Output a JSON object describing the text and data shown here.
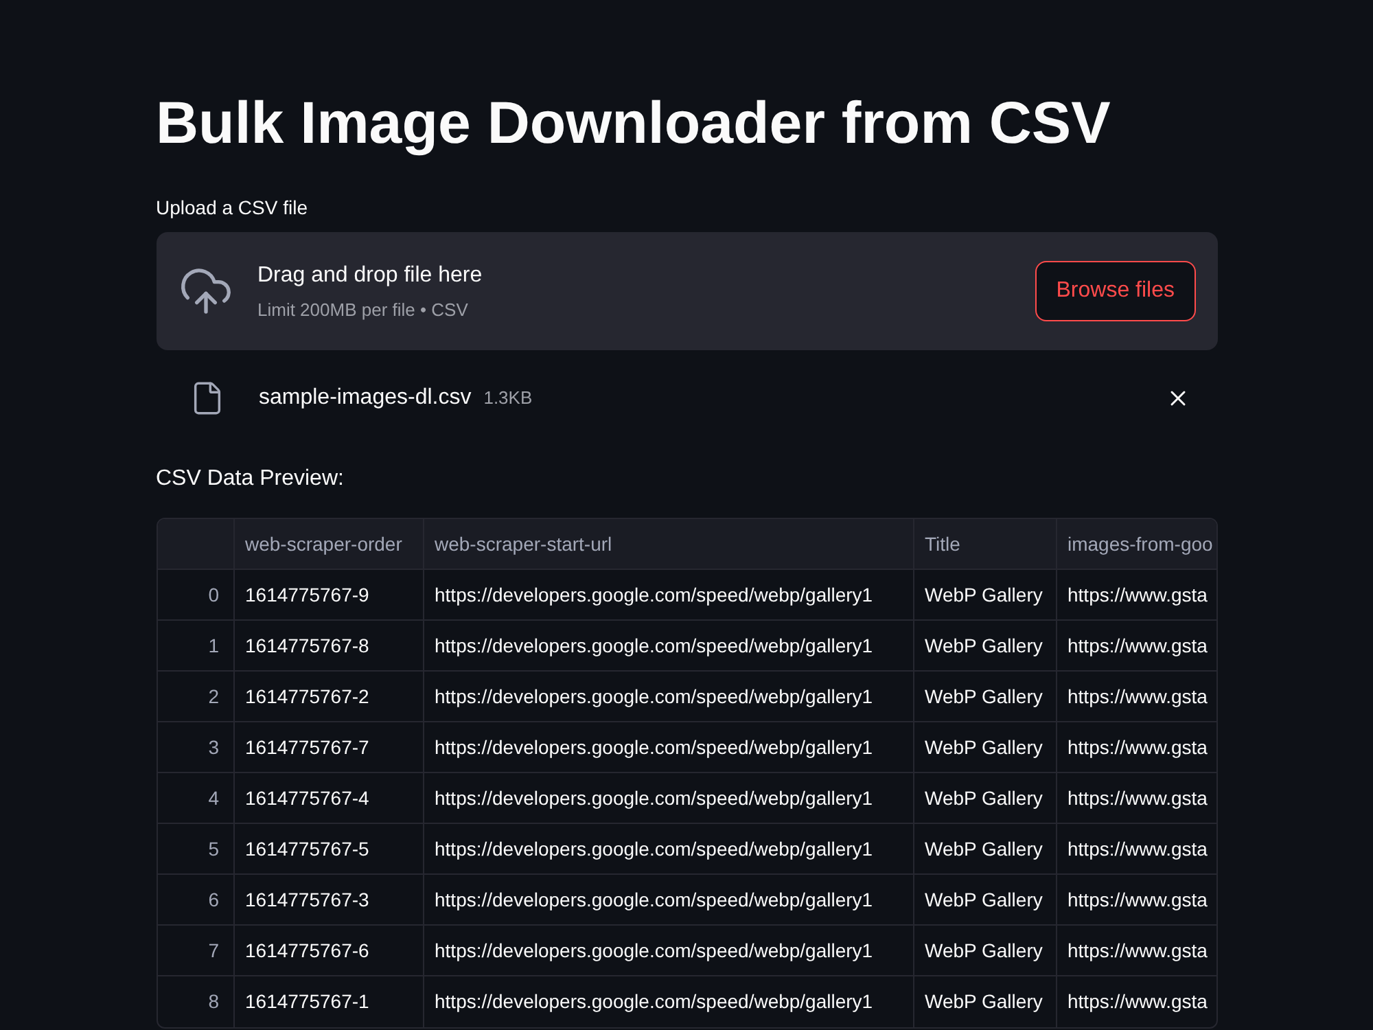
{
  "title": "Bulk Image Downloader from CSV",
  "uploader": {
    "label": "Upload a CSV file",
    "prompt": "Drag and drop file here",
    "limit": "Limit 200MB per file • CSV",
    "button": "Browse files"
  },
  "file": {
    "name": "sample-images-dl.csv",
    "size": "1.3KB"
  },
  "preview": {
    "heading": "CSV Data Preview:",
    "columns": [
      "web-scraper-order",
      "web-scraper-start-url",
      "Title",
      "images-from-goo"
    ],
    "rows": [
      {
        "index": "0",
        "cells": [
          "1614775767-9",
          "https://developers.google.com/speed/webp/gallery1",
          "WebP Gallery",
          "https://www.gsta"
        ]
      },
      {
        "index": "1",
        "cells": [
          "1614775767-8",
          "https://developers.google.com/speed/webp/gallery1",
          "WebP Gallery",
          "https://www.gsta"
        ]
      },
      {
        "index": "2",
        "cells": [
          "1614775767-2",
          "https://developers.google.com/speed/webp/gallery1",
          "WebP Gallery",
          "https://www.gsta"
        ]
      },
      {
        "index": "3",
        "cells": [
          "1614775767-7",
          "https://developers.google.com/speed/webp/gallery1",
          "WebP Gallery",
          "https://www.gsta"
        ]
      },
      {
        "index": "4",
        "cells": [
          "1614775767-4",
          "https://developers.google.com/speed/webp/gallery1",
          "WebP Gallery",
          "https://www.gsta"
        ]
      },
      {
        "index": "5",
        "cells": [
          "1614775767-5",
          "https://developers.google.com/speed/webp/gallery1",
          "WebP Gallery",
          "https://www.gsta"
        ]
      },
      {
        "index": "6",
        "cells": [
          "1614775767-3",
          "https://developers.google.com/speed/webp/gallery1",
          "WebP Gallery",
          "https://www.gsta"
        ]
      },
      {
        "index": "7",
        "cells": [
          "1614775767-6",
          "https://developers.google.com/speed/webp/gallery1",
          "WebP Gallery",
          "https://www.gsta"
        ]
      },
      {
        "index": "8",
        "cells": [
          "1614775767-1",
          "https://developers.google.com/speed/webp/gallery1",
          "WebP Gallery",
          "https://www.gsta"
        ]
      }
    ]
  }
}
